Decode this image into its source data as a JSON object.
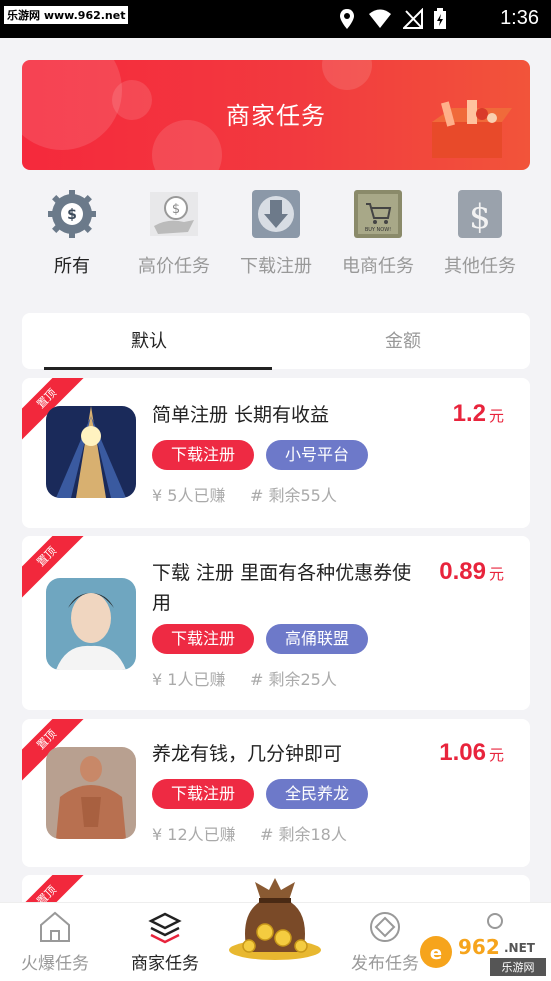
{
  "status_bar": {
    "watermark": "乐游网 www.962.net",
    "time": "1:36",
    "icons": [
      "location-icon",
      "wifi-icon",
      "signal-icon",
      "battery-icon"
    ]
  },
  "banner": {
    "title": "商家任务"
  },
  "categories": [
    {
      "label": "所有",
      "icon": "gear-icon",
      "active": true
    },
    {
      "label": "高价任务",
      "icon": "dollar-hand-icon",
      "active": false
    },
    {
      "label": "下载注册",
      "icon": "download-icon",
      "active": false
    },
    {
      "label": "电商任务",
      "icon": "cart-icon",
      "active": false
    },
    {
      "label": "其他任务",
      "icon": "dollar-icon",
      "active": false
    }
  ],
  "tabs": [
    {
      "label": "默认",
      "active": true
    },
    {
      "label": "金额",
      "active": false
    }
  ],
  "tasks": [
    {
      "ribbon": "置顶",
      "title": "简单注册 长期有收益",
      "price": "1.2",
      "unit": "元",
      "tag1": "下载注册",
      "tag2": "小号平台",
      "earned": "¥ 5人已赚",
      "remaining": "# 剩余55人"
    },
    {
      "ribbon": "置顶",
      "title_line1": "下载 注册 里面有各种优惠券使",
      "title_line2": "用",
      "price": "0.89",
      "unit": "元",
      "tag1": "下载注册",
      "tag2": "高俑联盟",
      "earned": "¥ 1人已赚",
      "remaining": "# 剩余25人"
    },
    {
      "ribbon": "置顶",
      "title": "养龙有钱，几分钟即可",
      "price": "1.06",
      "unit": "元",
      "tag1": "下载注册",
      "tag2": "全民养龙",
      "earned": "¥ 12人已赚",
      "remaining": "# 剩余18人"
    },
    {
      "ribbon": "置顶"
    }
  ],
  "bottom_nav": [
    {
      "label": "火爆任务",
      "icon": "home-icon",
      "active": false
    },
    {
      "label": "商家任务",
      "icon": "layers-icon",
      "active": true
    },
    {
      "label": "",
      "icon": "money-bag-icon",
      "active": false
    },
    {
      "label": "发布任务",
      "icon": "publish-icon",
      "active": false
    },
    {
      "label": "",
      "icon": "user-icon",
      "active": false
    }
  ],
  "footer_watermark": "962.NET 乐游网",
  "colors": {
    "accent": "#e8243c",
    "tag_red": "#ee2a43",
    "tag_blue": "#6d79c9"
  }
}
